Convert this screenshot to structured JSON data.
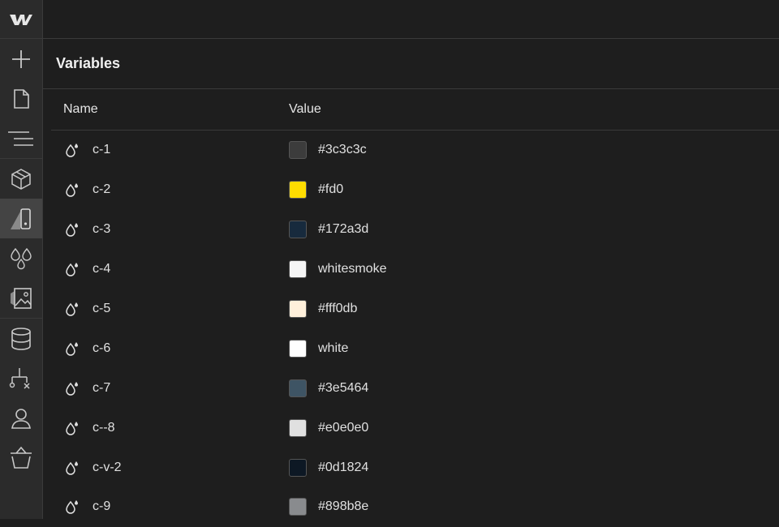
{
  "panel": {
    "title": "Variables",
    "columns": {
      "name": "Name",
      "value": "Value"
    }
  },
  "sidebar": {
    "items": [
      {
        "name": "add-icon"
      },
      {
        "name": "page-icon"
      },
      {
        "name": "navigator-icon"
      },
      {
        "name": "components-icon"
      },
      {
        "name": "style-selectors-icon",
        "active": true
      },
      {
        "name": "variables-icon"
      },
      {
        "name": "assets-icon"
      },
      {
        "name": "cms-icon"
      },
      {
        "name": "logic-icon"
      },
      {
        "name": "users-icon"
      },
      {
        "name": "ecommerce-icon"
      }
    ]
  },
  "variables": [
    {
      "name": "c-1",
      "value": "#3c3c3c",
      "color": "#3c3c3c"
    },
    {
      "name": "c-2",
      "value": "#fd0",
      "color": "#ffdd00"
    },
    {
      "name": "c-3",
      "value": "#172a3d",
      "color": "#172a3d"
    },
    {
      "name": "c-4",
      "value": "whitesmoke",
      "color": "#f5f5f5"
    },
    {
      "name": "c-5",
      "value": "#fff0db",
      "color": "#fff0db"
    },
    {
      "name": "c-6",
      "value": "white",
      "color": "#ffffff"
    },
    {
      "name": "c-7",
      "value": "#3e5464",
      "color": "#3e5464"
    },
    {
      "name": "c--8",
      "value": "#e0e0e0",
      "color": "#e0e0e0"
    },
    {
      "name": "c-v-2",
      "value": "#0d1824",
      "color": "#0d1824"
    },
    {
      "name": "c-9",
      "value": "#898b8e",
      "color": "#898b8e"
    }
  ]
}
